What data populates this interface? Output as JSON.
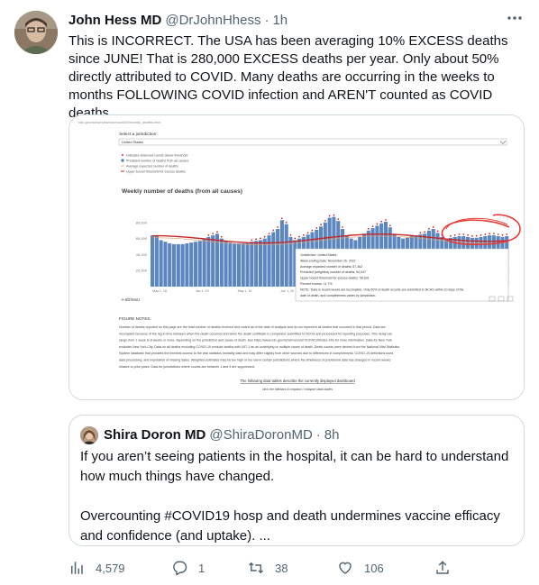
{
  "tweet": {
    "author_name": "John Hess MD",
    "author_handle": "@DrJohnHhess",
    "separator": "·",
    "time": "1h",
    "text": "This is INCORRECT. The USA has been averaging 10% EXCESS deaths since JUNE! That is 280,000 EXCESS deaths per year. Only about 50% directly attributed to COVID. Many deaths are occurring in the weeks to months FOLLOWING COVID infection and AREN'T counted as COVID deaths",
    "more_icon": "more-horizontal-icon"
  },
  "media": {
    "url": "cdc.gov/nchs/nvss/vsrr/covid19/excess_deaths.htm",
    "select_label": "Select a jurisdiction:",
    "select_value": "United States",
    "legend": [
      "Indicates observed counts above threshold",
      "Predicted number of deaths from all causes",
      "Average expected number of deaths",
      "Upper bound threshold for excess deaths"
    ],
    "chart_title": "Weekly number of deaths (from all causes)",
    "y_ticks": [
      "80,000",
      "60,000",
      "40,000",
      "20,000"
    ],
    "x_ticks": [
      "May 1, 18",
      "Jan 1, 19",
      "May 1, 19",
      "Jan 1, 20",
      "May 1, 20",
      "Jan 1, 21",
      "May 1, 21",
      "Jan 1, 22",
      "May 1, 22"
    ],
    "tooltip": [
      "Jurisdiction: United States",
      "Week-ending Date: November 26, 2022",
      "Average expected number of deaths: 57,362",
      "Predicted (weighted) number of deaths: 64,047",
      "Upper bound threshold for excess deaths: 58,631",
      "Percent excess: 11.7%",
      "NOTE: Data in recent weeks are incomplete. Only 60% of death records are submitted to NCHS within 10 days of the",
      "date of death, and completeness varies by jurisdiction."
    ],
    "tableau_label": "+ableau",
    "notes_title": "FIGURE NOTES:",
    "notes_text": [
      "Number of deaths reported on this page are the total number of deaths received and coded as of the date of analysis and do not represent all deaths that occurred in that period. Data are",
      "incomplete because of the lag in time between when the death occurred and when the death certificate is completed, submitted to NCHS and processed for reporting purposes. This delay can",
      "range from 1 week to 8 weeks or more, depending on the jurisdiction and cause of death. See https://www.cdc.gov/nchs/nvss/vsrr/COVID19/index.htm for more information. Data for New York",
      "excludes New York City. Data on all deaths excluding COVID-19 exclude deaths with U07.1 as an underlying or multiple cause of death. Death counts were derived from the National Vital Statistics",
      "System database that provides the timeliest access to the vital statistics mortality data and may differ slightly from other sources due to differences in completeness, COVID-19 definitions used,",
      "data processing, and imputation of missing dates. Weighted estimates may be too high or too low in certain jurisdictions where the timeliness of provisional data has changed in recent weeks",
      "relative to prior years. Data for jurisdictions where counts are between 1 and 9 are suppressed."
    ],
    "dashboard_link": "The following data tables describe the currently displayed dashboard",
    "expand_hint": "click the titlebars to expand / collapse data tables",
    "chart_data": {
      "type": "bar",
      "title": "Weekly number of deaths (from all causes)",
      "x_range": [
        "2018-01",
        "2022-11"
      ],
      "ylim": [
        0,
        90000
      ],
      "threshold_series": "Upper bound threshold for excess deaths",
      "highlighted_point": {
        "week_ending": "November 26, 2022",
        "average_expected": 57362,
        "predicted": 64047,
        "upper_bound_threshold": 58631,
        "percent_excess": 11.7
      },
      "values": [
        64000,
        63000,
        58000,
        56000,
        54000,
        53000,
        53000,
        53000,
        54000,
        55000,
        56000,
        57000,
        59000,
        62000,
        64000,
        66000,
        60000,
        57000,
        55000,
        54000,
        54000,
        54000,
        55000,
        56000,
        57000,
        58000,
        60000,
        64000,
        68000,
        72000,
        83000,
        78000,
        62000,
        58000,
        60000,
        62000,
        65000,
        68000,
        71000,
        75000,
        80000,
        86000,
        87000,
        82000,
        72000,
        64000,
        60000,
        58000,
        62000,
        66000,
        70000,
        73000,
        76000,
        79000,
        81000,
        74000,
        66000,
        62000,
        60000,
        61000,
        63000,
        64000,
        65000,
        66000,
        70000,
        72000,
        67000,
        62000,
        60000,
        61000,
        62000,
        63000,
        63000,
        62000,
        61000,
        61000,
        62000,
        63000,
        64000,
        64000,
        63000,
        62000,
        63000
      ]
    }
  },
  "quote": {
    "author_name": "Shira Doron MD",
    "author_handle": "@ShiraDoronMD",
    "separator": "·",
    "time": "8h",
    "text": "If you aren’t seeing patients in the hospital, it can be hard to understand how much things have changed.\n\nOvercounting #COVID19 hosp and death undermines vaccine efficacy and confidence (and uptake). ..."
  },
  "actions": {
    "views": "4,579",
    "replies": "1",
    "retweets": "38",
    "likes": "106",
    "icons": [
      "analytics-icon",
      "reply-icon",
      "retweet-icon",
      "like-icon",
      "share-icon"
    ]
  }
}
